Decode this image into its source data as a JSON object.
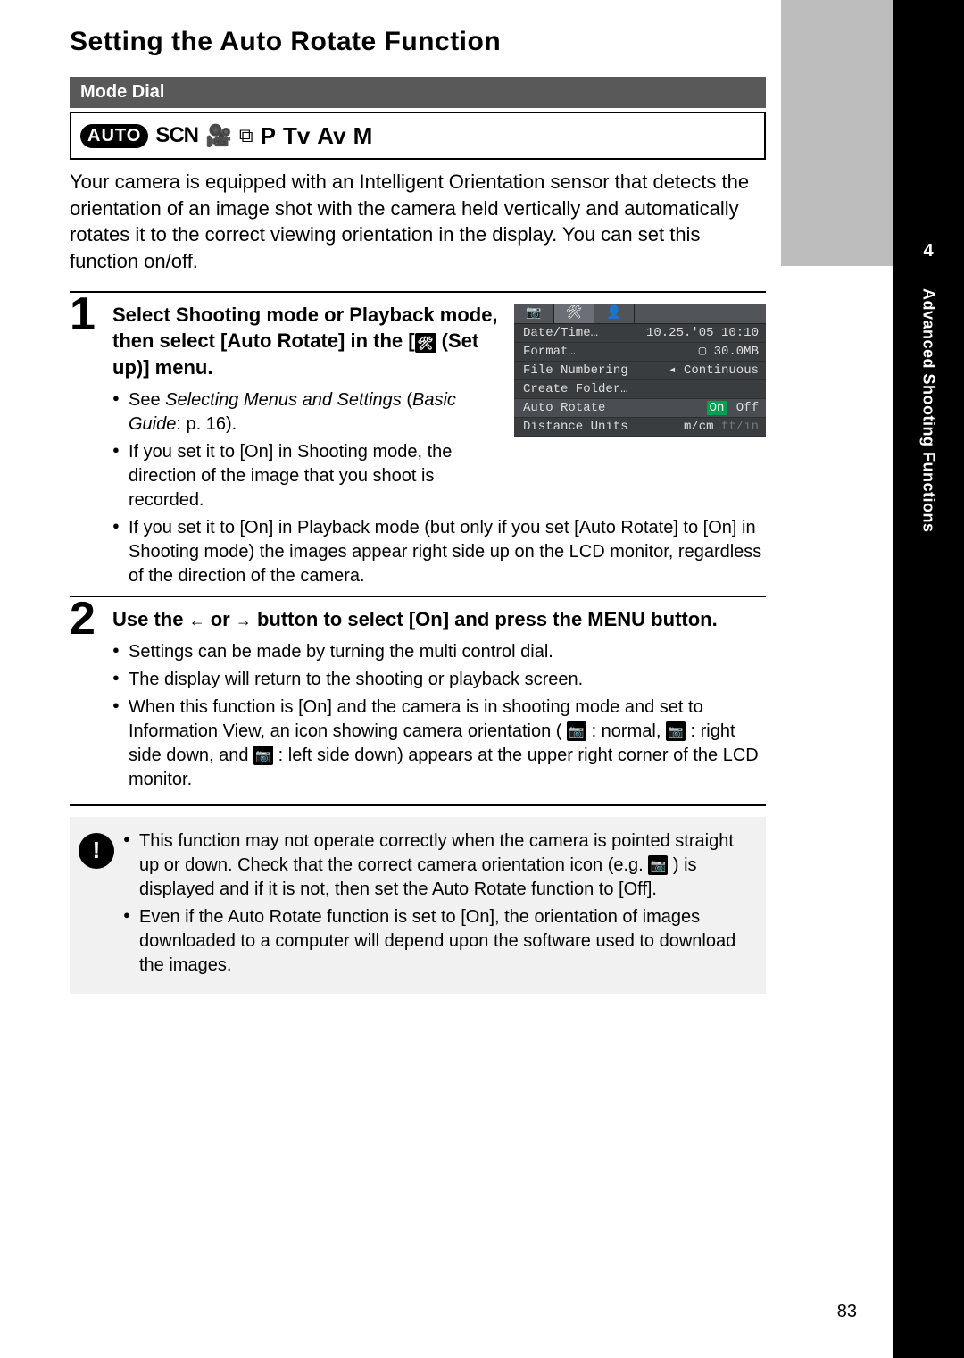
{
  "title": "Setting the Auto Rotate Function",
  "mode_dial_label": "Mode Dial",
  "mode_icons": {
    "auto": "AUTO",
    "scn": "SCN",
    "p": "P",
    "tv": "Tv",
    "av": "Av",
    "m": "M"
  },
  "intro": "Your camera is equipped with an Intelligent Orientation sensor that detects the orientation of an image shot with the camera held vertically and automatically rotates it to the correct viewing orientation in the display. You can set this function on/off.",
  "step1": {
    "num": "1",
    "head_a": "Select Shooting mode or Playback mode, then select [Auto Rotate] in the [",
    "head_b": " (Set up)] menu.",
    "b1a": "See ",
    "b1b": "Selecting Menus and Settings",
    "b1c": " (",
    "b1d": "Basic Guide",
    "b1e": ": p. 16).",
    "b2": "If you set it to [On] in Shooting mode, the direction of the image that you shoot is recorded.",
    "b3": "If you set it to [On] in Playback mode (but only if you set [Auto Rotate] to [On] in Shooting mode) the images appear right side up on the LCD monitor, regardless of the direction of the camera."
  },
  "step2": {
    "num": "2",
    "head_a": "Use the ",
    "head_b": " or ",
    "head_c": " button to select [On] and press the MENU button.",
    "b1": "Settings can be made by turning the multi control dial.",
    "b2": "The display will return to the shooting or playback screen.",
    "b3a": "When this function is [On] and the camera is in shooting mode and set to Information View, an icon showing camera orientation ( ",
    "b3b": " : normal, ",
    "b3c": " : right side down, and ",
    "b3d": " : left side down) appears at the upper right corner of the LCD monitor."
  },
  "note": {
    "b1a": "This function may not operate correctly when the camera is pointed straight up or down. Check that the correct camera orientation icon (e.g. ",
    "b1b": " ) is displayed and if it is not, then set the Auto Rotate function to [Off].",
    "b2": "Even if the Auto Rotate function is set to [On], the orientation of images downloaded to a computer will depend upon the software used to download the images."
  },
  "lcd": {
    "rows": [
      {
        "l": "Date/Time…",
        "r": "10.25.'05 10:10"
      },
      {
        "l": "Format…",
        "r": "▢  30.0MB"
      },
      {
        "l": "File Numbering",
        "r": "◂ Continuous"
      },
      {
        "l": "Create Folder…",
        "r": ""
      },
      {
        "l": "Auto Rotate",
        "on": "On",
        "off": "Off"
      },
      {
        "l": "Distance Units",
        "r": "m/cm",
        "dim": "ft/in"
      }
    ]
  },
  "side": {
    "num": "4",
    "label": "Advanced Shooting Functions"
  },
  "page_num": "83"
}
